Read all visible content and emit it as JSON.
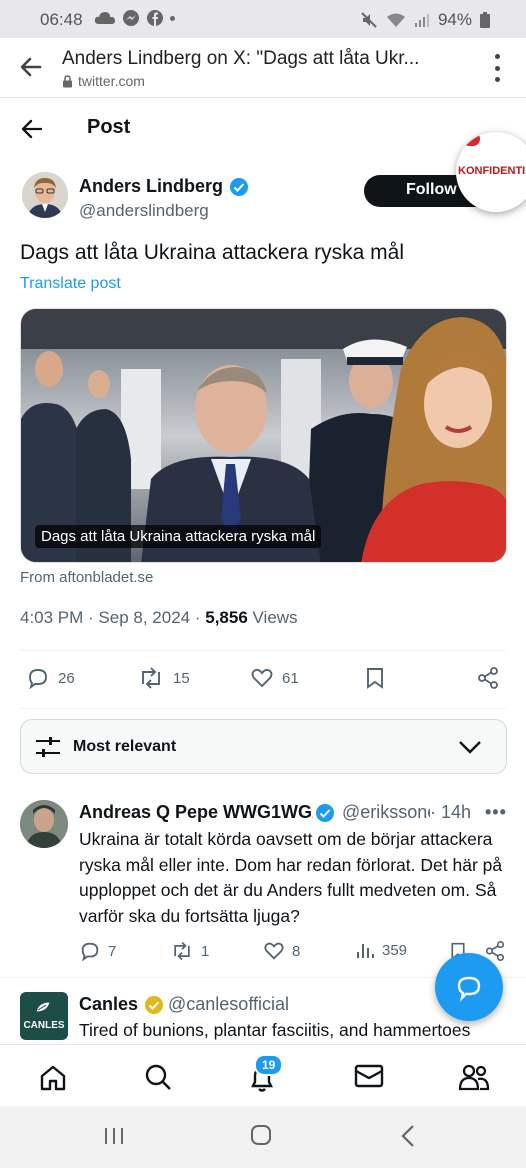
{
  "status_bar": {
    "time": "06:48",
    "battery": "94%"
  },
  "browser": {
    "title": "Anders Lindberg on X: \"Dags att låta Ukr...",
    "url": "twitter.com"
  },
  "post_header": {
    "title": "Post"
  },
  "author": {
    "name": "Anders Lindberg",
    "handle": "@anderslindberg",
    "follow_label": "Follow",
    "overlay_badge": "KONFIDENTIELL"
  },
  "tweet": {
    "text": "Dags att låta Ukraina attackera ryska mål",
    "translate_label": "Translate post",
    "card_caption": "Dags att låta Ukraina attackera ryska mål",
    "source": "From aftonbladet.se",
    "time": "4:03 PM",
    "date": "Sep 8, 2024",
    "views_count": "5,856",
    "views_label": "Views",
    "replies": "26",
    "reposts": "15",
    "likes": "61"
  },
  "sort": {
    "label": "Most relevant"
  },
  "reply": {
    "name": "Andreas Q Pepe WWG1WGA",
    "handle": "@erikssoné",
    "time": "· 14h",
    "text": "Ukraina är totalt körda oavsett om de börjar attackera ryska mål eller inte. Dom har redan förlorat. Det här på upploppet och det är du Anders fullt medveten om. Så varför ska du fortsätta ljuga?",
    "replies": "7",
    "reposts": "1",
    "likes": "8",
    "views": "359"
  },
  "ad": {
    "logo_text": "CANLES",
    "name": "Canles",
    "handle": "@canlesofficial",
    "text": "Tired of bunions, plantar fasciitis, and hammertoes"
  },
  "tabbar": {
    "notifications_badge": "19"
  },
  "colors": {
    "accent": "#1d9bf0",
    "text": "#0f1419",
    "muted": "#536471",
    "verified_blue": "#1d9bf0",
    "verified_gold": "#e2b719"
  }
}
